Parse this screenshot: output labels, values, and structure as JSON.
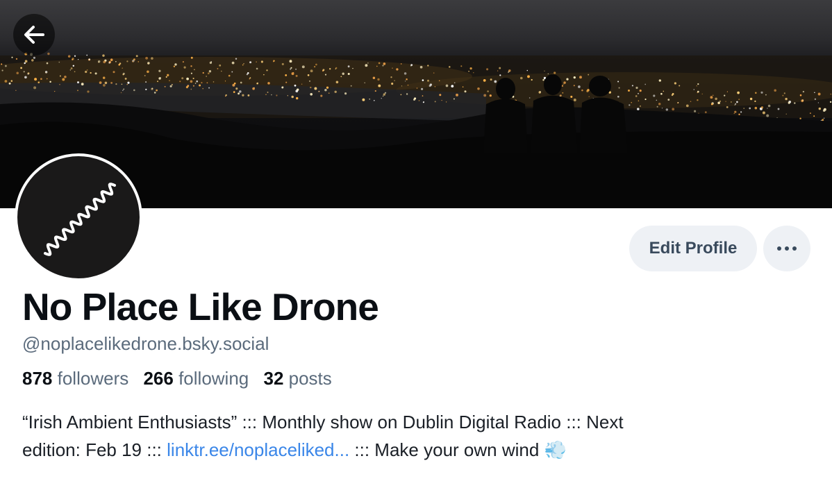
{
  "profile": {
    "display_name": "No Place Like Drone",
    "handle": "@noplacelikedrone.bsky.social",
    "stats": {
      "followers_count": "878",
      "followers_label": "followers",
      "following_count": "266",
      "following_label": "following",
      "posts_count": "32",
      "posts_label": "posts"
    },
    "bio": {
      "line1": "“Irish Ambient Enthusiasts” ::: Monthly show on Dublin Digital Radio ::: Next",
      "line2_prefix": "edition: Feb 19 ::: ",
      "link_text": "linktr.ee/noplaceliked...",
      "line2_suffix": " ::: Make your own wind ",
      "emoji": "💨"
    }
  },
  "actions": {
    "edit_profile_label": "Edit Profile"
  },
  "icons": {
    "back": "arrow-left-icon",
    "more": "ellipsis-icon",
    "avatar": "wavy-line-logo"
  },
  "colors": {
    "link": "#3a86e8",
    "button_bg": "#eef1f5",
    "muted_text": "#5b6b7c"
  }
}
